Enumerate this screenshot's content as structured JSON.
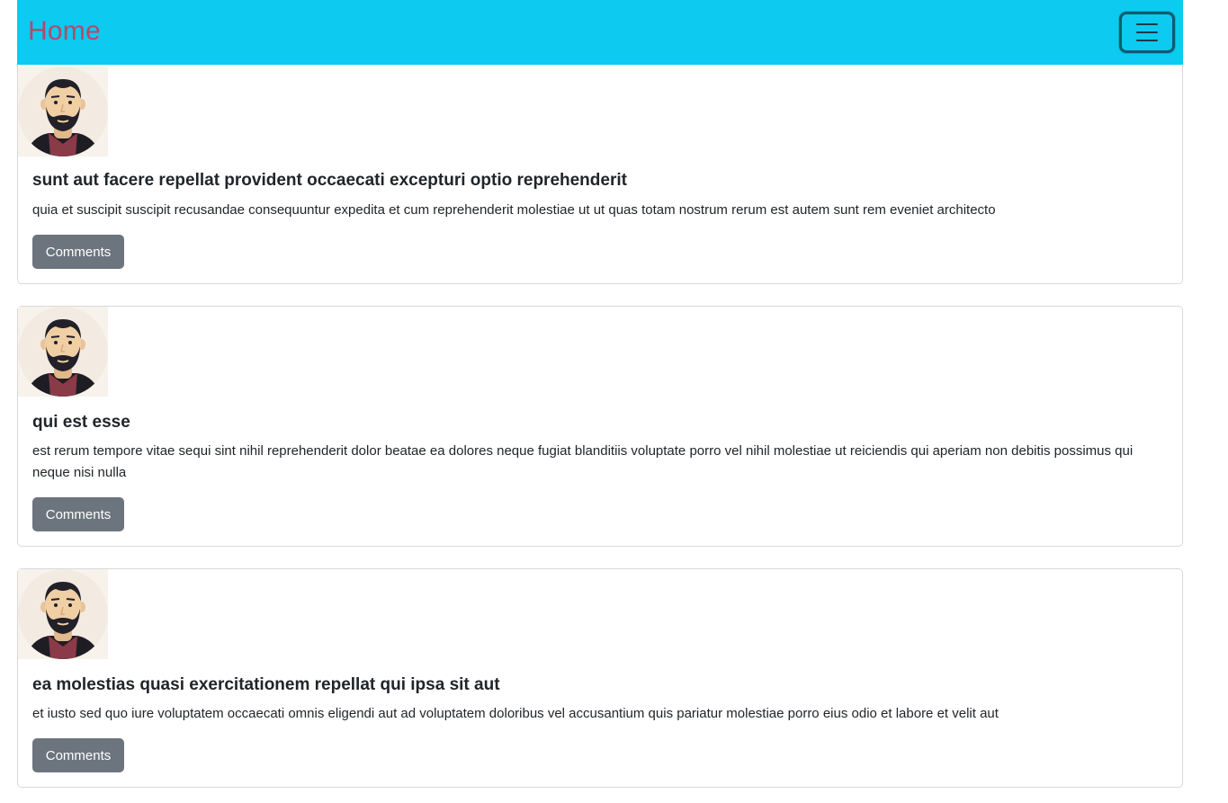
{
  "navbar": {
    "brand": "Home",
    "toggler_icon": "hamburger-menu-icon",
    "background": "#0dcaf0",
    "brand_color": "#b34a6a"
  },
  "posts": [
    {
      "avatar_icon": "bearded-man-avatar",
      "title": "sunt aut facere repellat provident occaecati excepturi optio reprehenderit",
      "body": "quia et suscipit suscipit recusandae consequuntur expedita et cum reprehenderit molestiae ut ut quas totam nostrum rerum est autem sunt rem eveniet architecto",
      "button_label": "Comments"
    },
    {
      "avatar_icon": "bearded-man-avatar",
      "title": "qui est esse",
      "body": "est rerum tempore vitae sequi sint nihil reprehenderit dolor beatae ea dolores neque fugiat blanditiis voluptate porro vel nihil molestiae ut reiciendis qui aperiam non debitis possimus qui neque nisi nulla",
      "button_label": "Comments"
    },
    {
      "avatar_icon": "bearded-man-avatar",
      "title": "ea molestias quasi exercitationem repellat qui ipsa sit aut",
      "body": "et iusto sed quo iure voluptatem occaecati omnis eligendi aut ad voluptatem doloribus vel accusantium quis pariatur molestiae porro eius odio et labore et velit aut",
      "button_label": "Comments"
    }
  ],
  "colors": {
    "button": "#6c757d",
    "text": "#212529",
    "card_border": "#d9d9d9"
  }
}
